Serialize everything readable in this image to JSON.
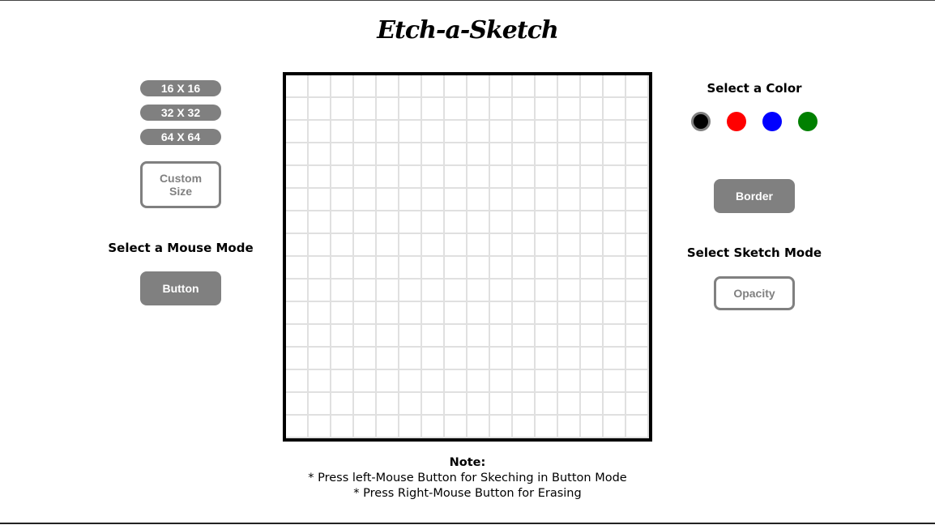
{
  "app": {
    "title": "Etch-a-Sketch"
  },
  "size_buttons": [
    {
      "label": "16 X 16"
    },
    {
      "label": "32 X 32"
    },
    {
      "label": "64 X 64"
    }
  ],
  "custom_size": {
    "label": "Custom Size"
  },
  "mouse_mode": {
    "heading": "Select a Mouse Mode",
    "button_label": "Button"
  },
  "color_picker": {
    "heading": "Select a Color",
    "colors": [
      {
        "name": "black",
        "hex": "#000000",
        "selected": true
      },
      {
        "name": "red",
        "hex": "#ff0000",
        "selected": false
      },
      {
        "name": "blue",
        "hex": "#0000ff",
        "selected": false
      },
      {
        "name": "green",
        "hex": "#008000",
        "selected": false
      }
    ]
  },
  "border_toggle": {
    "label": "Border"
  },
  "sketch_mode": {
    "heading": "Select Sketch Mode",
    "button_label": "Opacity"
  },
  "canvas": {
    "grid_size": 16
  },
  "note": {
    "title": "Note:",
    "lines": [
      "* Press left-Mouse Button for Skeching in Button Mode",
      "* Press Right-Mouse Button for Erasing"
    ]
  },
  "colors": {
    "button_gray": "#808080",
    "grid_line": "#e0e0e0",
    "canvas_border": "#000000"
  }
}
